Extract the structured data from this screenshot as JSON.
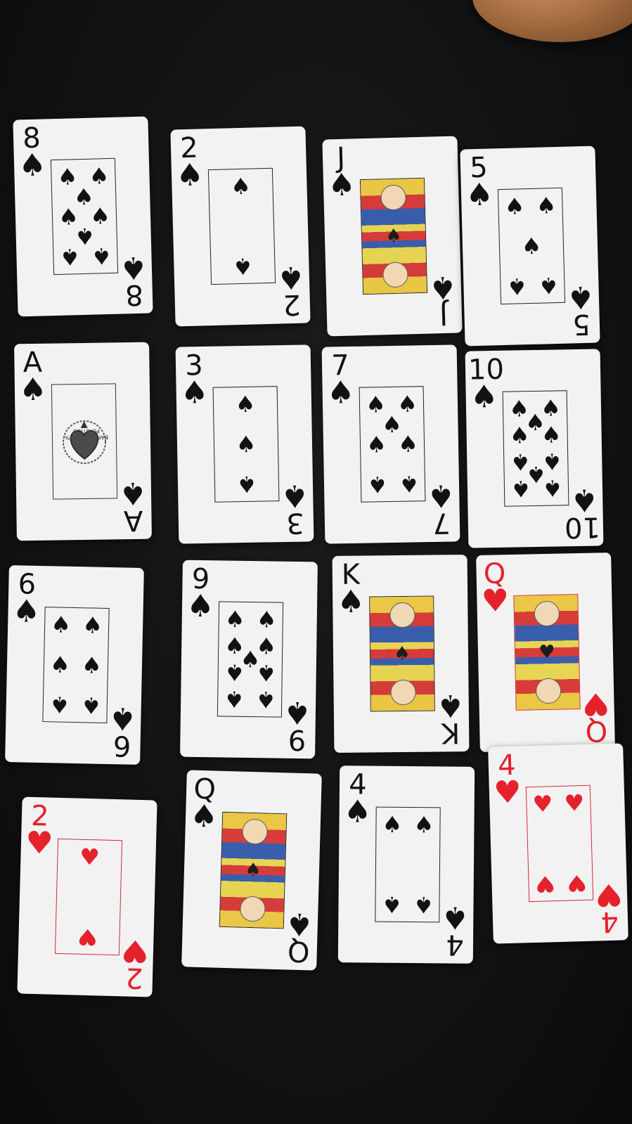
{
  "scene": {
    "colors": {
      "table": "#131314",
      "card": "#f2f2f3",
      "black": "#121212",
      "red": "#e5222c"
    },
    "object_top_right": "wooden-round-object"
  },
  "cards": [
    {
      "rank": "8",
      "suit": "♠",
      "color": "black",
      "pips": 8
    },
    {
      "rank": "2",
      "suit": "♠",
      "color": "black",
      "pips": 2
    },
    {
      "rank": "J",
      "suit": "♠",
      "color": "black",
      "face": true
    },
    {
      "rank": "5",
      "suit": "♠",
      "color": "black",
      "pips": 5
    },
    {
      "rank": "A",
      "suit": "♠",
      "color": "black",
      "ace": true,
      "ace_text": "BARALHO 100% PLÁSTICO"
    },
    {
      "rank": "3",
      "suit": "♠",
      "color": "black",
      "pips": 3
    },
    {
      "rank": "7",
      "suit": "♠",
      "color": "black",
      "pips": 7
    },
    {
      "rank": "10",
      "suit": "♠",
      "color": "black",
      "pips": 10
    },
    {
      "rank": "6",
      "suit": "♠",
      "color": "black",
      "pips": 6
    },
    {
      "rank": "9",
      "suit": "♠",
      "color": "black",
      "pips": 9
    },
    {
      "rank": "K",
      "suit": "♠",
      "color": "black",
      "face": true
    },
    {
      "rank": "Q",
      "suit": "♥",
      "color": "red",
      "face": true
    },
    {
      "rank": "2",
      "suit": "♥",
      "color": "red",
      "pips": 2
    },
    {
      "rank": "Q",
      "suit": "♠",
      "color": "black",
      "face": true
    },
    {
      "rank": "4",
      "suit": "♠",
      "color": "black",
      "pips": 4
    },
    {
      "rank": "4",
      "suit": "♥",
      "color": "red",
      "pips": 4
    }
  ]
}
